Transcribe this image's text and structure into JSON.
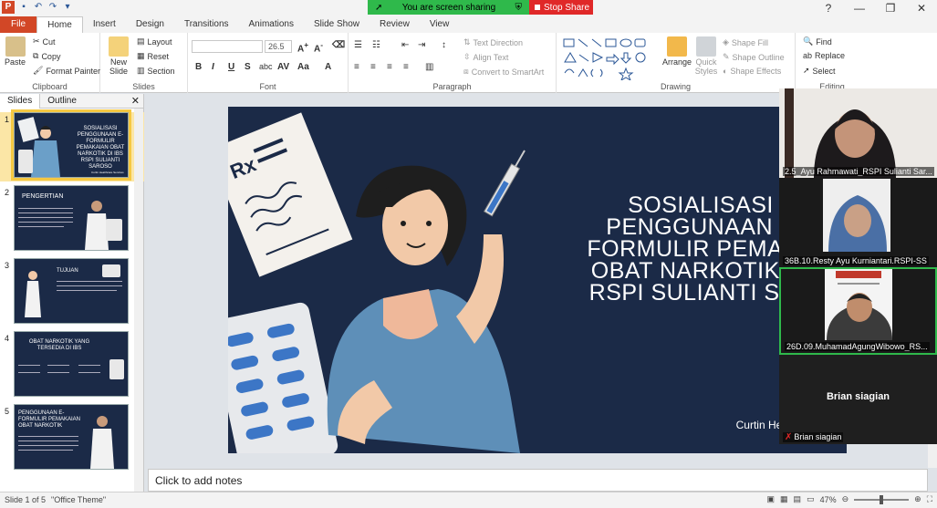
{
  "titlebar": {
    "app_logo": "P",
    "window_controls": [
      "?",
      "—",
      "❐",
      "✕"
    ]
  },
  "share": {
    "status": "You are screen sharing",
    "stop_label": "Stop Share",
    "color_green": "#2fb94b",
    "color_red": "#e02828"
  },
  "ribbon_tabs": [
    "File",
    "Home",
    "Insert",
    "Design",
    "Transitions",
    "Animations",
    "Slide Show",
    "Review",
    "View"
  ],
  "ribbon": {
    "clipboard": {
      "paste": "Paste",
      "cut": "Cut",
      "copy": "Copy",
      "format_painter": "Format Painter",
      "label": "Clipboard"
    },
    "slides": {
      "new_slide": "New Slide",
      "layout": "Layout",
      "reset": "Reset",
      "section": "Section",
      "label": "Slides"
    },
    "font": {
      "size": "26.5",
      "label": "Font"
    },
    "paragraph": {
      "text_direction": "Text Direction",
      "align_text": "Align Text",
      "convert_smartart": "Convert to SmartArt",
      "label": "Paragraph"
    },
    "drawing": {
      "arrange": "Arrange",
      "quick_styles": "Quick Styles",
      "shape_fill": "Shape Fill",
      "shape_outline": "Shape Outline",
      "shape_effects": "Shape Effects",
      "label": "Drawing"
    },
    "editing": {
      "find": "Find",
      "replace": "Replace",
      "select": "Select",
      "label": "Editing"
    }
  },
  "left_panel": {
    "tab_slides": "Slides",
    "tab_outline": "Outline",
    "close": "✕",
    "thumbnails": [
      {
        "num": "1",
        "title": "SOSIALISASI PENGGUNAAN E-FORMULIR PEMAKAIAN OBAT NARKOTIK DI IBS RSPI SULIANTI SAROSO",
        "footer": "Curtin Healthcare Services"
      },
      {
        "num": "2",
        "title": "PENGERTIAN"
      },
      {
        "num": "3",
        "title": "TUJUAN"
      },
      {
        "num": "4",
        "title": "OBAT NARKOTIK YANG TERSEDIA DI IBS"
      },
      {
        "num": "5",
        "title": "PENGGUNAAN E-FORMULIR PEMAKAIAN OBAT NARKOTIK"
      }
    ]
  },
  "slide": {
    "title_lines": [
      "SOSIALISASI",
      "PENGGUNAAN E",
      "FORMULIR PEMAKA",
      "OBAT NARKOTIK DI",
      "RSPI SULIANTI SAR"
    ],
    "subtitle": "Curtin Healthcare Se",
    "bg_color": "#1b2a47"
  },
  "notes": {
    "placeholder": "Click to add notes"
  },
  "statusbar": {
    "slide_info": "Slide 1 of 5",
    "theme": "\"Office Theme\"",
    "zoom": "47%"
  },
  "participants": [
    {
      "name": "2.5_Ayu Rahmawati_RSPI Sulianti Sar..."
    },
    {
      "name": "36B.10.Resty Ayu Kurniantari.RSPI-SS"
    },
    {
      "name": "26D.09.MuhamadAgungWibowo_RS..."
    },
    {
      "display": "Brian siagian",
      "name": "Brian siagian"
    }
  ]
}
